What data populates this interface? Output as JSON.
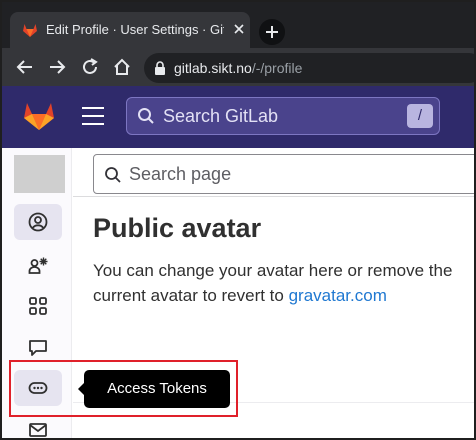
{
  "browser": {
    "tab": {
      "title": "Edit Profile · User Settings · GitLab"
    },
    "url": {
      "host": "gitlab.sikt.no",
      "path": "/-/profile"
    }
  },
  "header": {
    "search_placeholder": "Search GitLab",
    "search_shortcut": "/"
  },
  "sidebar": {
    "items": [
      {
        "name": "profile",
        "icon": "user-circle-icon",
        "active": true
      },
      {
        "name": "account",
        "icon": "user-gear-icon"
      },
      {
        "name": "applications",
        "icon": "grid-icon"
      },
      {
        "name": "chat",
        "icon": "comment-icon"
      },
      {
        "name": "access-tokens",
        "icon": "token-icon"
      },
      {
        "name": "emails",
        "icon": "mail-icon"
      }
    ]
  },
  "main": {
    "search_page_placeholder": "Search page",
    "avatar_section": {
      "title": "Public avatar",
      "description_prefix": "You can change your avatar here or remove the current avatar to revert to ",
      "link_text": "gravatar.com"
    }
  },
  "tooltip": {
    "text": "Access Tokens"
  },
  "colors": {
    "header_bg": "#2f2a6b",
    "link": "#1f78d1",
    "highlight": "#e0202a",
    "tooltip_bg": "#000000"
  }
}
